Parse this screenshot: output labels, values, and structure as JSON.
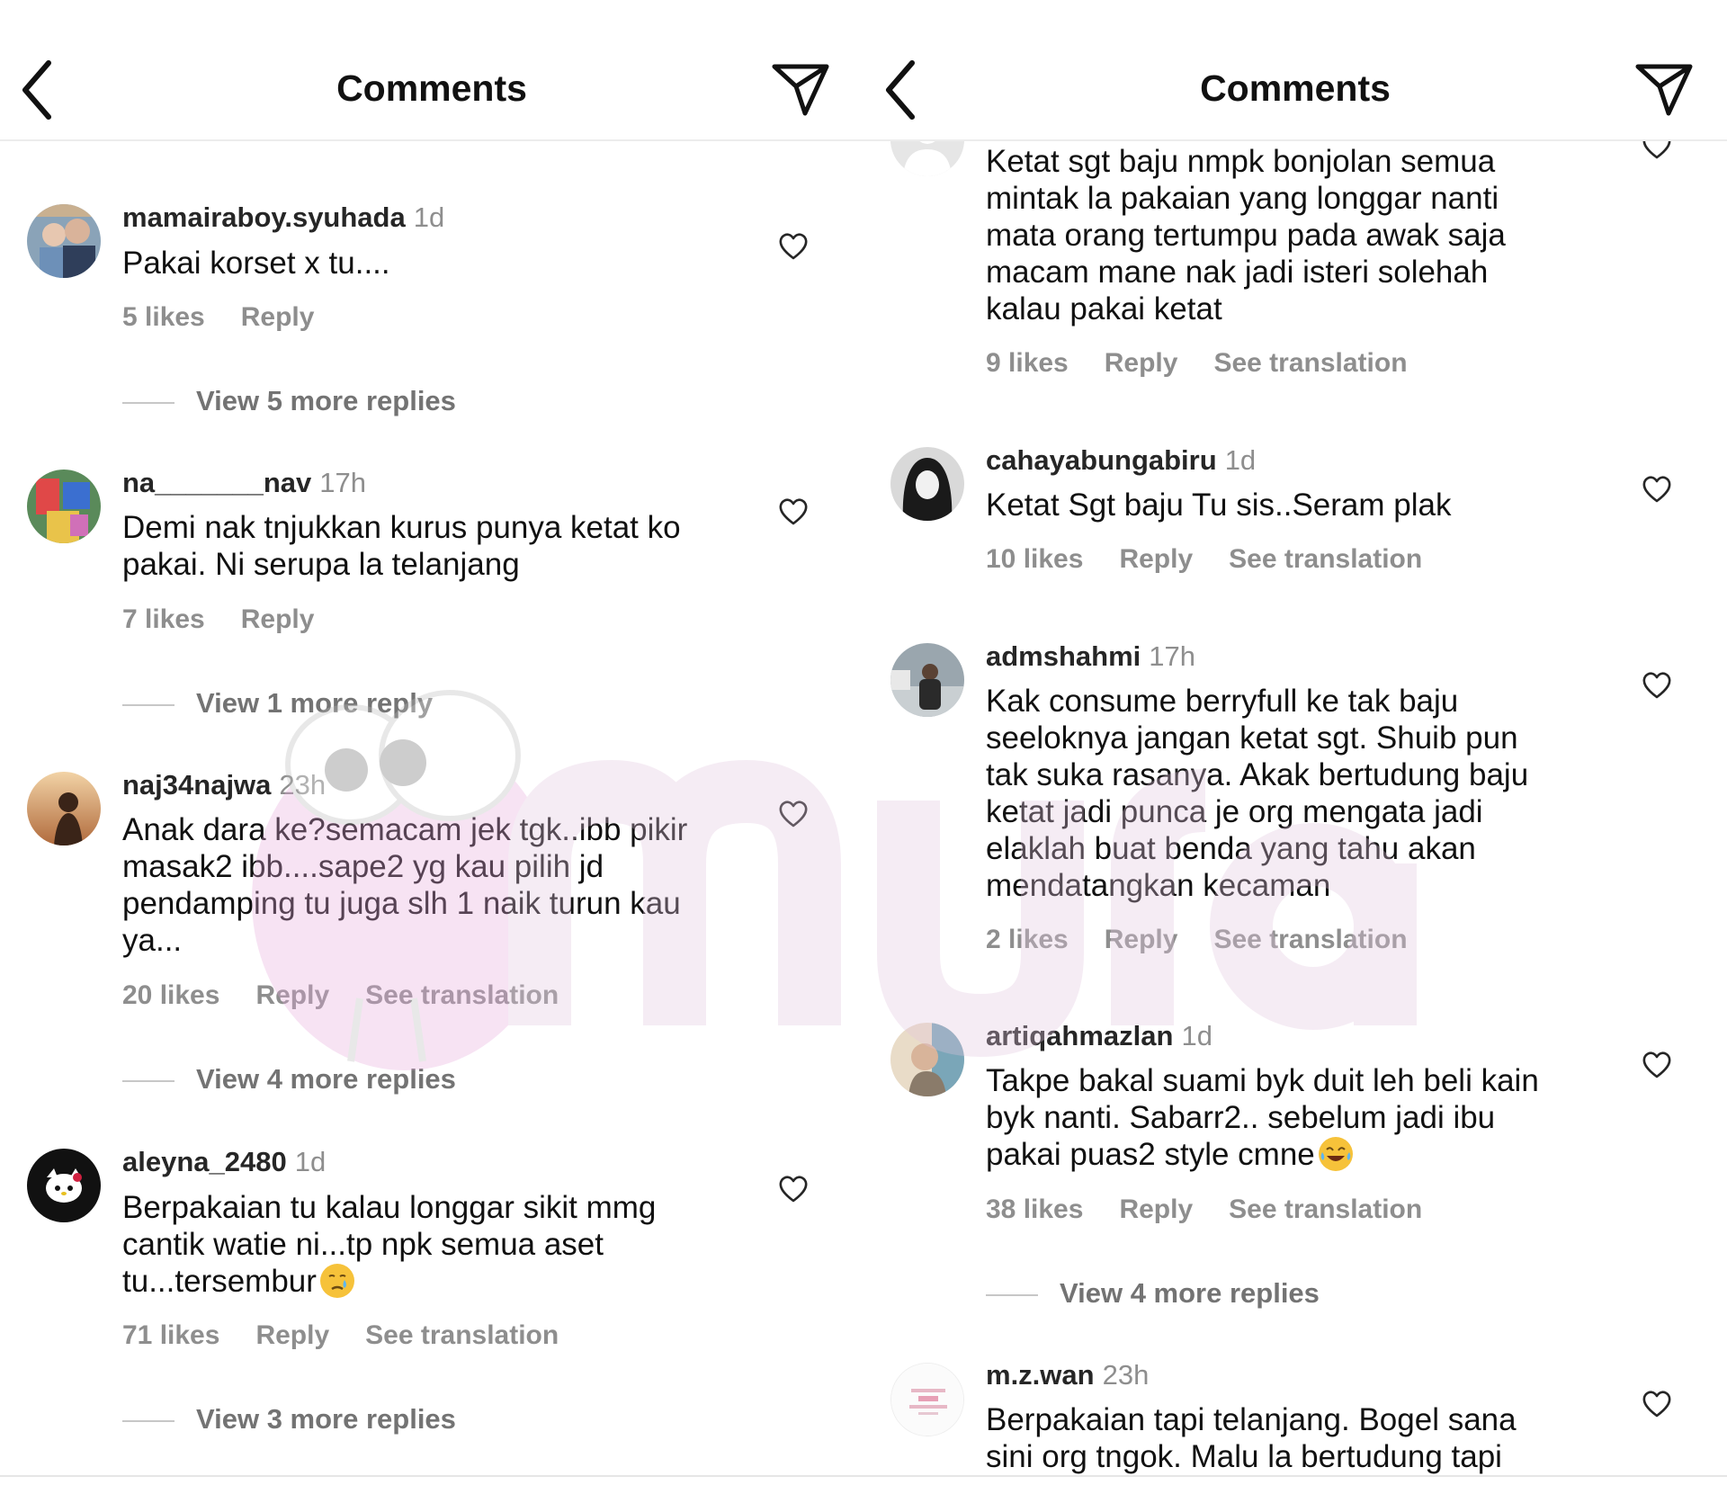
{
  "left": {
    "header": {
      "title": "Comments"
    },
    "comments": [
      {
        "username": "mamairaboy.syuhada",
        "time": "1d",
        "text": "Pakai korset x tu....",
        "likes": "5 likes",
        "reply": "Reply",
        "view_more": "View 5 more replies"
      },
      {
        "username": "na_______nav",
        "time": "17h",
        "text": "Demi nak tnjukkan kurus punya ketat ko\npakai. Ni serupa la telanjang",
        "likes": "7 likes",
        "reply": "Reply",
        "view_more": "View 1 more reply"
      },
      {
        "username": "naj34najwa",
        "time": "23h",
        "text": "Anak dara ke?semacam jek tgk..ibb pikir\nmasak2 ibb....sape2 yg kau pilih jd\npendamping tu juga slh 1 naik turun kau\nya...",
        "likes": "20 likes",
        "reply": "Reply",
        "translation": "See translation",
        "view_more": "View 4 more replies"
      },
      {
        "username": "aleyna_2480",
        "time": "1d",
        "text_lines": [
          "Berpakaian tu kalau longgar sikit mmg",
          "cantik watie ni...tp npk semua aset",
          "tu...tersembur"
        ],
        "emoji": "crying-face",
        "likes": "71 likes",
        "reply": "Reply",
        "translation": "See translation",
        "view_more": "View 3 more replies"
      }
    ]
  },
  "right": {
    "header": {
      "title": "Comments"
    },
    "comments": [
      {
        "text": "Ketat sgt baju nmpk bonjolan semua\nmintak la pakaian yang longgar nanti\nmata orang tertumpu pada awak saja\nmacam mane nak jadi isteri solehah\nkalau pakai ketat",
        "likes": "9 likes",
        "reply": "Reply",
        "translation": "See translation"
      },
      {
        "username": "cahayabungabiru",
        "time": "1d",
        "text": "Ketat Sgt baju Tu sis..Seram plak",
        "likes": "10 likes",
        "reply": "Reply",
        "translation": "See translation"
      },
      {
        "username": "admshahmi",
        "time": "17h",
        "text": "Kak consume berryfull ke tak baju\nseeloknya jangan ketat sgt. Shuib pun\ntak suka rasanya. Akak bertudung baju\nketat jadi punca je org mengata jadi\nelaklah buat benda yang tahu akan\nmendatangkan kecaman",
        "likes": "2 likes",
        "reply": "Reply",
        "translation": "See translation"
      },
      {
        "username": "artiqahmazlan",
        "time": "1d",
        "text_lines": [
          "Takpe bakal suami byk duit leh beli kain",
          "byk nanti. Sabarr2.. sebelum jadi ibu",
          "pakai puas2 style cmne"
        ],
        "emoji": "tears-of-joy",
        "likes": "38 likes",
        "reply": "Reply",
        "translation": "See translation",
        "view_more": "View 4 more replies"
      },
      {
        "username": "m.z.wan",
        "time": "23h",
        "text": "Berpakaian tapi telanjang. Bogel sana\nsini org tngok. Malu la bertudung tapi"
      }
    ]
  },
  "icons": {
    "back": "chevron-left-icon",
    "send": "paper-plane-icon",
    "like": "heart-outline-icon"
  },
  "colors": {
    "text": "#262626",
    "secondary": "#8e8e8e",
    "divider": "#ececec",
    "watermark": "#d9a8d6"
  }
}
